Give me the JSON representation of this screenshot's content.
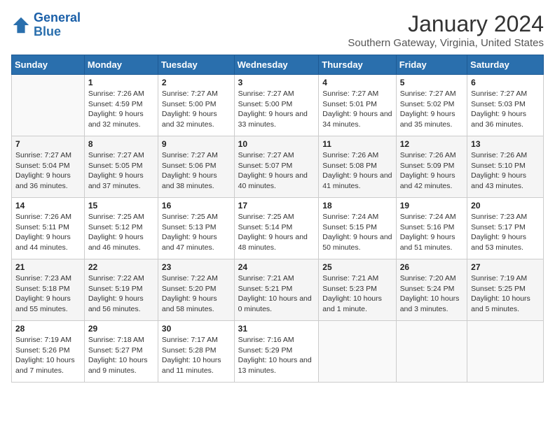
{
  "logo": {
    "line1": "General",
    "line2": "Blue"
  },
  "title": "January 2024",
  "subtitle": "Southern Gateway, Virginia, United States",
  "weekdays": [
    "Sunday",
    "Monday",
    "Tuesday",
    "Wednesday",
    "Thursday",
    "Friday",
    "Saturday"
  ],
  "weeks": [
    [
      {
        "day": "",
        "sunrise": "",
        "sunset": "",
        "daylight": ""
      },
      {
        "day": "1",
        "sunrise": "Sunrise: 7:26 AM",
        "sunset": "Sunset: 4:59 PM",
        "daylight": "Daylight: 9 hours and 32 minutes."
      },
      {
        "day": "2",
        "sunrise": "Sunrise: 7:27 AM",
        "sunset": "Sunset: 5:00 PM",
        "daylight": "Daylight: 9 hours and 32 minutes."
      },
      {
        "day": "3",
        "sunrise": "Sunrise: 7:27 AM",
        "sunset": "Sunset: 5:00 PM",
        "daylight": "Daylight: 9 hours and 33 minutes."
      },
      {
        "day": "4",
        "sunrise": "Sunrise: 7:27 AM",
        "sunset": "Sunset: 5:01 PM",
        "daylight": "Daylight: 9 hours and 34 minutes."
      },
      {
        "day": "5",
        "sunrise": "Sunrise: 7:27 AM",
        "sunset": "Sunset: 5:02 PM",
        "daylight": "Daylight: 9 hours and 35 minutes."
      },
      {
        "day": "6",
        "sunrise": "Sunrise: 7:27 AM",
        "sunset": "Sunset: 5:03 PM",
        "daylight": "Daylight: 9 hours and 36 minutes."
      }
    ],
    [
      {
        "day": "7",
        "sunrise": "Sunrise: 7:27 AM",
        "sunset": "Sunset: 5:04 PM",
        "daylight": "Daylight: 9 hours and 36 minutes."
      },
      {
        "day": "8",
        "sunrise": "Sunrise: 7:27 AM",
        "sunset": "Sunset: 5:05 PM",
        "daylight": "Daylight: 9 hours and 37 minutes."
      },
      {
        "day": "9",
        "sunrise": "Sunrise: 7:27 AM",
        "sunset": "Sunset: 5:06 PM",
        "daylight": "Daylight: 9 hours and 38 minutes."
      },
      {
        "day": "10",
        "sunrise": "Sunrise: 7:27 AM",
        "sunset": "Sunset: 5:07 PM",
        "daylight": "Daylight: 9 hours and 40 minutes."
      },
      {
        "day": "11",
        "sunrise": "Sunrise: 7:26 AM",
        "sunset": "Sunset: 5:08 PM",
        "daylight": "Daylight: 9 hours and 41 minutes."
      },
      {
        "day": "12",
        "sunrise": "Sunrise: 7:26 AM",
        "sunset": "Sunset: 5:09 PM",
        "daylight": "Daylight: 9 hours and 42 minutes."
      },
      {
        "day": "13",
        "sunrise": "Sunrise: 7:26 AM",
        "sunset": "Sunset: 5:10 PM",
        "daylight": "Daylight: 9 hours and 43 minutes."
      }
    ],
    [
      {
        "day": "14",
        "sunrise": "Sunrise: 7:26 AM",
        "sunset": "Sunset: 5:11 PM",
        "daylight": "Daylight: 9 hours and 44 minutes."
      },
      {
        "day": "15",
        "sunrise": "Sunrise: 7:25 AM",
        "sunset": "Sunset: 5:12 PM",
        "daylight": "Daylight: 9 hours and 46 minutes."
      },
      {
        "day": "16",
        "sunrise": "Sunrise: 7:25 AM",
        "sunset": "Sunset: 5:13 PM",
        "daylight": "Daylight: 9 hours and 47 minutes."
      },
      {
        "day": "17",
        "sunrise": "Sunrise: 7:25 AM",
        "sunset": "Sunset: 5:14 PM",
        "daylight": "Daylight: 9 hours and 48 minutes."
      },
      {
        "day": "18",
        "sunrise": "Sunrise: 7:24 AM",
        "sunset": "Sunset: 5:15 PM",
        "daylight": "Daylight: 9 hours and 50 minutes."
      },
      {
        "day": "19",
        "sunrise": "Sunrise: 7:24 AM",
        "sunset": "Sunset: 5:16 PM",
        "daylight": "Daylight: 9 hours and 51 minutes."
      },
      {
        "day": "20",
        "sunrise": "Sunrise: 7:23 AM",
        "sunset": "Sunset: 5:17 PM",
        "daylight": "Daylight: 9 hours and 53 minutes."
      }
    ],
    [
      {
        "day": "21",
        "sunrise": "Sunrise: 7:23 AM",
        "sunset": "Sunset: 5:18 PM",
        "daylight": "Daylight: 9 hours and 55 minutes."
      },
      {
        "day": "22",
        "sunrise": "Sunrise: 7:22 AM",
        "sunset": "Sunset: 5:19 PM",
        "daylight": "Daylight: 9 hours and 56 minutes."
      },
      {
        "day": "23",
        "sunrise": "Sunrise: 7:22 AM",
        "sunset": "Sunset: 5:20 PM",
        "daylight": "Daylight: 9 hours and 58 minutes."
      },
      {
        "day": "24",
        "sunrise": "Sunrise: 7:21 AM",
        "sunset": "Sunset: 5:21 PM",
        "daylight": "Daylight: 10 hours and 0 minutes."
      },
      {
        "day": "25",
        "sunrise": "Sunrise: 7:21 AM",
        "sunset": "Sunset: 5:23 PM",
        "daylight": "Daylight: 10 hours and 1 minute."
      },
      {
        "day": "26",
        "sunrise": "Sunrise: 7:20 AM",
        "sunset": "Sunset: 5:24 PM",
        "daylight": "Daylight: 10 hours and 3 minutes."
      },
      {
        "day": "27",
        "sunrise": "Sunrise: 7:19 AM",
        "sunset": "Sunset: 5:25 PM",
        "daylight": "Daylight: 10 hours and 5 minutes."
      }
    ],
    [
      {
        "day": "28",
        "sunrise": "Sunrise: 7:19 AM",
        "sunset": "Sunset: 5:26 PM",
        "daylight": "Daylight: 10 hours and 7 minutes."
      },
      {
        "day": "29",
        "sunrise": "Sunrise: 7:18 AM",
        "sunset": "Sunset: 5:27 PM",
        "daylight": "Daylight: 10 hours and 9 minutes."
      },
      {
        "day": "30",
        "sunrise": "Sunrise: 7:17 AM",
        "sunset": "Sunset: 5:28 PM",
        "daylight": "Daylight: 10 hours and 11 minutes."
      },
      {
        "day": "31",
        "sunrise": "Sunrise: 7:16 AM",
        "sunset": "Sunset: 5:29 PM",
        "daylight": "Daylight: 10 hours and 13 minutes."
      },
      {
        "day": "",
        "sunrise": "",
        "sunset": "",
        "daylight": ""
      },
      {
        "day": "",
        "sunrise": "",
        "sunset": "",
        "daylight": ""
      },
      {
        "day": "",
        "sunrise": "",
        "sunset": "",
        "daylight": ""
      }
    ]
  ]
}
